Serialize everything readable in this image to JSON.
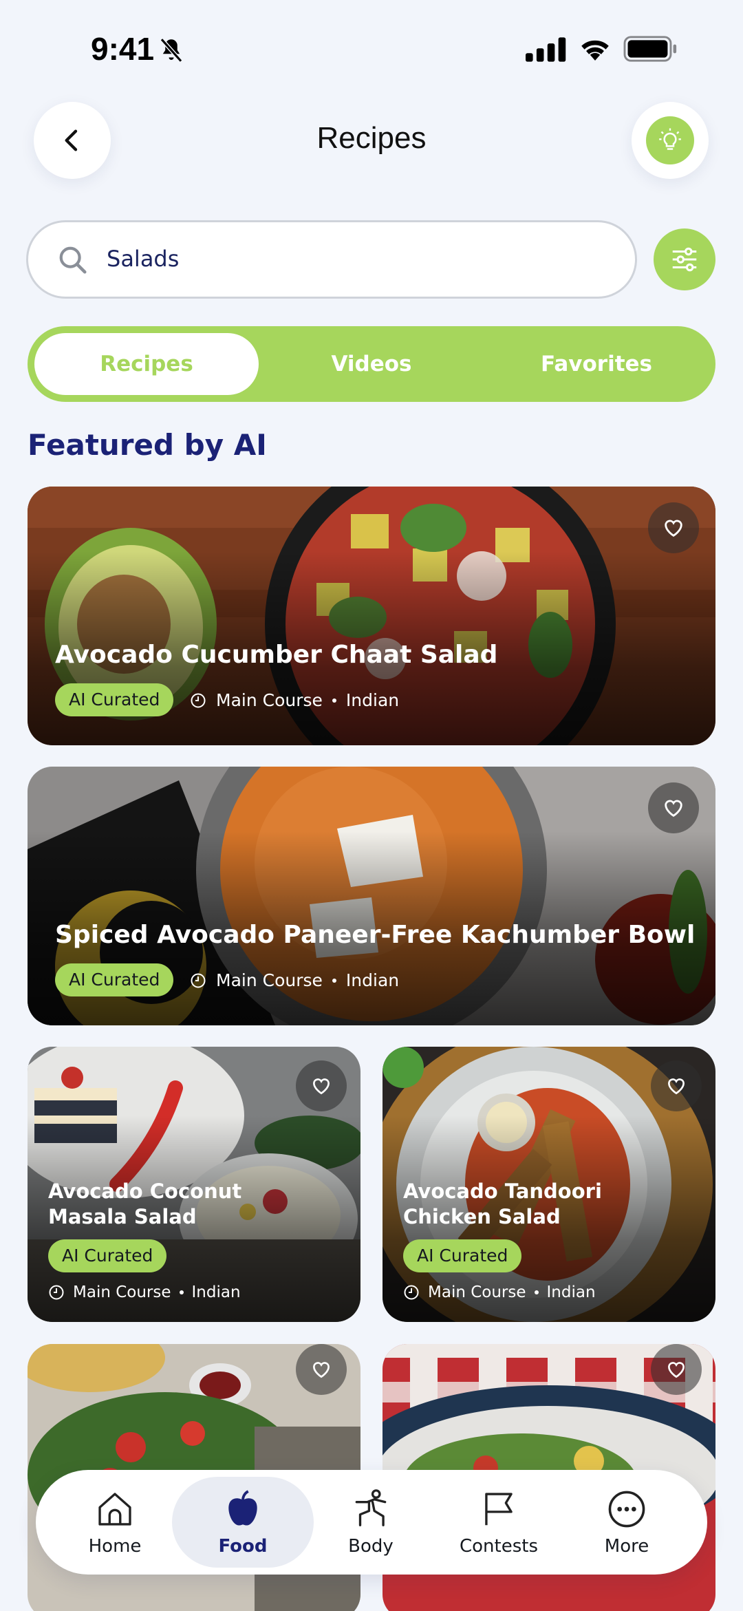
{
  "status_bar": {
    "time": "9:41",
    "icons": [
      "bell-off-icon",
      "signal-icon",
      "wifi-icon",
      "battery-icon"
    ]
  },
  "header": {
    "title": "Recipes",
    "back_icon": "chevron-left-icon",
    "tips_icon": "lightbulb-icon"
  },
  "search": {
    "value": "Salads",
    "icon": "search-icon",
    "filter_icon": "sliders-icon"
  },
  "tabs": [
    {
      "label": "Recipes",
      "active": true
    },
    {
      "label": "Videos",
      "active": false
    },
    {
      "label": "Favorites",
      "active": false
    }
  ],
  "section": {
    "title": "Featured by AI"
  },
  "recipes": [
    {
      "title": "Avocado Cucumber Chaat Salad",
      "badge": "AI Curated",
      "course": "Main Course",
      "cuisine": "Indian"
    },
    {
      "title": "Spiced Avocado Paneer-Free Kachumber Bowl",
      "badge": "AI Curated",
      "course": "Main Course",
      "cuisine": "Indian"
    },
    {
      "title_line1": "Avocado Coconut",
      "title_line2": "Masala Salad",
      "badge": "AI Curated",
      "course": "Main Course",
      "cuisine": "Indian"
    },
    {
      "title_line1": "Avocado Tandoori",
      "title_line2": "Chicken Salad",
      "badge": "AI Curated",
      "course": "Main Course",
      "cuisine": "Indian"
    }
  ],
  "bottom_nav": [
    {
      "label": "Home",
      "icon": "home-icon",
      "active": false
    },
    {
      "label": "Food",
      "icon": "apple-icon",
      "active": true
    },
    {
      "label": "Body",
      "icon": "body-icon",
      "active": false
    },
    {
      "label": "Contests",
      "icon": "flag-icon",
      "active": false
    },
    {
      "label": "More",
      "icon": "more-icon",
      "active": false
    }
  ],
  "colors": {
    "accent": "#a6d65c",
    "heading": "#1b2276",
    "background": "#f2f5fb"
  }
}
